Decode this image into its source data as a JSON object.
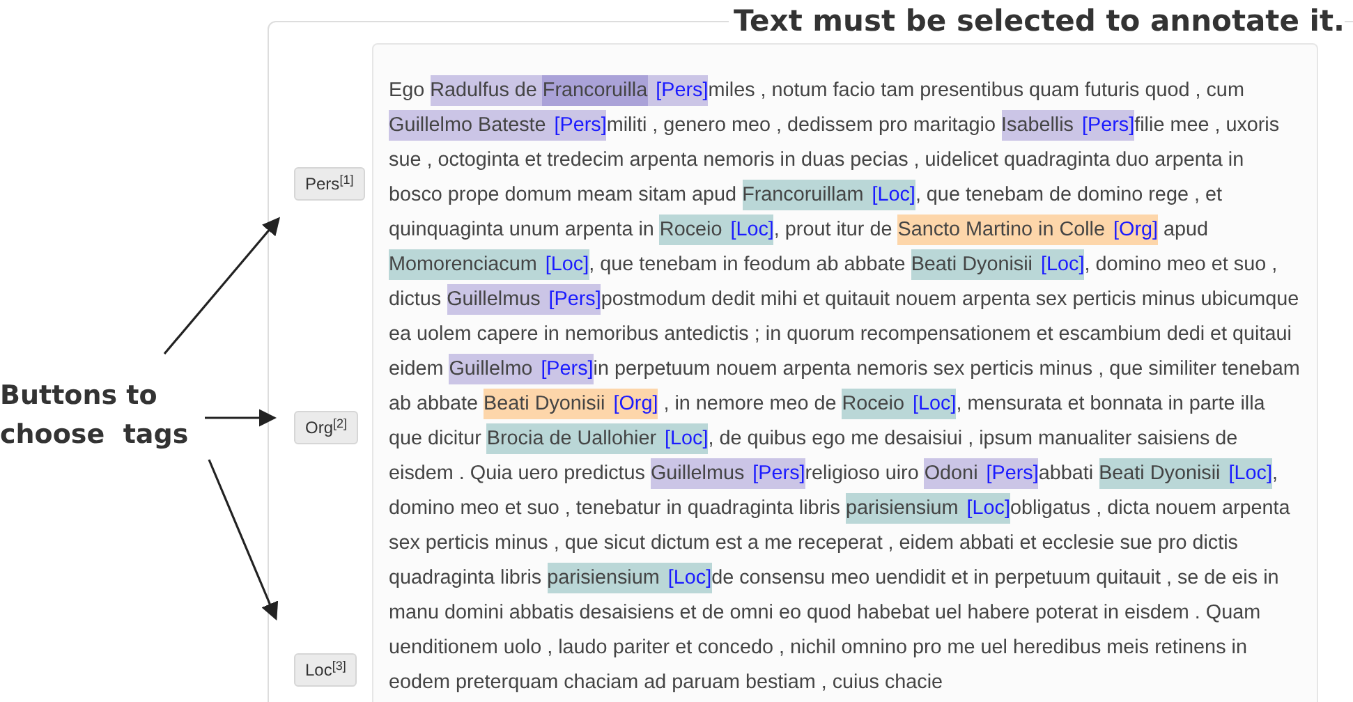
{
  "instruction": "Text must be selected to annotate it.",
  "callout": {
    "text": "Buttons to choose  tags"
  },
  "tag_buttons": [
    {
      "label": "Pers$^{[1]}$"
    },
    {
      "label": "Org$^{[2]}$"
    },
    {
      "label": "Loc$^{[3]}$"
    }
  ],
  "segments": [
    {
      "kind": "text",
      "text": "Ego "
    },
    {
      "kind": "entity",
      "tag": "[Pers]",
      "color": "#cbc5e6",
      "parts": [
        {
          "text": "Radulfus de "
        },
        {
          "text": "Francoruilla",
          "color": "#aaa2d8"
        }
      ]
    },
    {
      "kind": "text",
      "text": "miles , notum facio tam presentibus quam futuris quod , cum "
    },
    {
      "kind": "entity",
      "tag": "[Pers]",
      "color": "#cbc5e6",
      "text": "Guillelmo Bateste"
    },
    {
      "kind": "text",
      "text": "militi , genero meo , dedissem pro maritagio "
    },
    {
      "kind": "entity",
      "tag": "[Pers]",
      "color": "#cbc5e6",
      "text": "Isabellis"
    },
    {
      "kind": "text",
      "text": "filie mee , uxoris sue , octoginta et tredecim arpenta nemoris in duas pecias , uidelicet quadraginta duo arpenta in bosco prope domum meam sitam apud "
    },
    {
      "kind": "entity",
      "tag": "[Loc]",
      "color": "#bad7d7",
      "text": "Francoruillam"
    },
    {
      "kind": "text",
      "text": ", que tenebam de domino rege , et quinquaginta unum arpenta in "
    },
    {
      "kind": "entity",
      "tag": "[Loc]",
      "color": "#bad7d7",
      "text": "Roceio"
    },
    {
      "kind": "text",
      "text": ", prout itur de "
    },
    {
      "kind": "entity",
      "tag": "[Org]",
      "color": "#fdd6aa",
      "text": "Sancto Martino in Colle"
    },
    {
      "kind": "text",
      "text": " apud "
    },
    {
      "kind": "entity",
      "tag": "[Loc]",
      "color": "#bad7d7",
      "text": "Momorenciacum"
    },
    {
      "kind": "text",
      "text": ", que tenebam in feodum ab abbate "
    },
    {
      "kind": "entity",
      "tag": "[Loc]",
      "color": "#bad7d7",
      "text": "Beati Dyonisii"
    },
    {
      "kind": "text",
      "text": ", domino meo et suo , dictus "
    },
    {
      "kind": "entity",
      "tag": "[Pers]",
      "color": "#cbc5e6",
      "text": "Guillelmus"
    },
    {
      "kind": "text",
      "text": "postmodum dedit mihi et quitauit nouem arpenta sex perticis minus ubicumque ea uolem capere in nemoribus antedictis ; in quorum recompensationem et escambium dedi et quitaui eidem "
    },
    {
      "kind": "entity",
      "tag": "[Pers]",
      "color": "#cbc5e6",
      "text": "Guillelmo"
    },
    {
      "kind": "text",
      "text": "in perpetuum nouem arpenta nemoris sex perticis minus , que similiter tenebam ab abbate "
    },
    {
      "kind": "entity",
      "tag": "[Org]",
      "color": "#fdd6aa",
      "text": "Beati Dyonisii"
    },
    {
      "kind": "text",
      "text": " , in nemore meo de "
    },
    {
      "kind": "entity",
      "tag": "[Loc]",
      "color": "#bad7d7",
      "text": "Roceio"
    },
    {
      "kind": "text",
      "text": ", mensurata et bonnata in parte illa que dicitur "
    },
    {
      "kind": "entity",
      "tag": "[Loc]",
      "color": "#bad7d7",
      "text": "Brocia de Uallohier"
    },
    {
      "kind": "text",
      "text": ", de quibus ego me desaisiui , ipsum manualiter saisiens de eisdem . Quia uero predictus "
    },
    {
      "kind": "entity",
      "tag": "[Pers]",
      "color": "#cbc5e6",
      "text": "Guillelmus"
    },
    {
      "kind": "text",
      "text": "religioso uiro "
    },
    {
      "kind": "entity",
      "tag": "[Pers]",
      "color": "#cbc5e6",
      "text": "Odoni"
    },
    {
      "kind": "text",
      "text": "abbati "
    },
    {
      "kind": "entity",
      "tag": "[Loc]",
      "color": "#bad7d7",
      "text": "Beati Dyonisii"
    },
    {
      "kind": "text",
      "text": ", domino meo et suo , tenebatur in quadraginta libris "
    },
    {
      "kind": "entity",
      "tag": "[Loc]",
      "color": "#bad7d7",
      "text": "parisiensium"
    },
    {
      "kind": "text",
      "text": "obligatus , dicta nouem arpenta sex perticis minus , que sicut dictum est a me receperat , eidem abbati et ecclesie sue pro dictis quadraginta libris "
    },
    {
      "kind": "entity",
      "tag": "[Loc]",
      "color": "#bad7d7",
      "text": "parisiensium"
    },
    {
      "kind": "text",
      "text": "de consensu meo uendidit et in perpetuum quitauit , se de eis in manu domini abbatis desaisiens et de omni eo quod habebat uel habere poterat in eisdem . Quam uenditionem uolo , laudo pariter et concedo , nichil omnino pro me uel heredibus meis retinens in eodem preterquam chaciam ad paruam bestiam , cuius chacie"
    }
  ]
}
